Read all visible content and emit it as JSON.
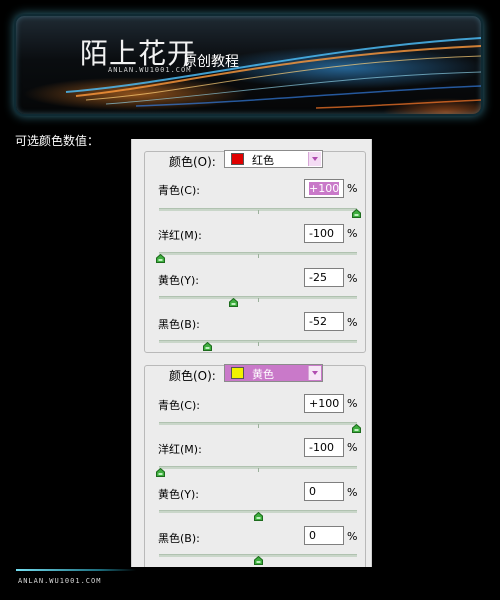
{
  "banner": {
    "title": "陌上花开",
    "subtitle": "原创教程",
    "url": "ANLAN.WU1001.COM"
  },
  "caption": "可选颜色数值：",
  "panels": [
    {
      "color_label": "颜色(O):",
      "selected_color": "红色",
      "swatch_color": "#e00000",
      "selector_highlighted": false,
      "sliders": [
        {
          "label": "青色(C):",
          "value": "+100",
          "percent_sign": "%",
          "level": 100
        },
        {
          "label": "洋红(M):",
          "value": "-100",
          "percent_sign": "%",
          "level": -100
        },
        {
          "label": "黄色(Y):",
          "value": "-25",
          "percent_sign": "%",
          "level": -25
        },
        {
          "label": "黑色(B):",
          "value": "-52",
          "percent_sign": "%",
          "level": -52
        }
      ]
    },
    {
      "color_label": "颜色(O):",
      "selected_color": "黄色",
      "swatch_color": "#f2f200",
      "selector_highlighted": true,
      "sliders": [
        {
          "label": "青色(C):",
          "value": "+100",
          "percent_sign": "%",
          "level": 100
        },
        {
          "label": "洋红(M):",
          "value": "-100",
          "percent_sign": "%",
          "level": -100
        },
        {
          "label": "黄色(Y):",
          "value": "0",
          "percent_sign": "%",
          "level": 0
        },
        {
          "label": "黑色(B):",
          "value": "0",
          "percent_sign": "%",
          "level": 0
        }
      ]
    }
  ],
  "footer": {
    "url": "ANLAN.WU1001.COM"
  },
  "colors": {
    "accent_cyan": "#76e0f2",
    "highlight_magenta": "#c979c9",
    "thumb_green": "#3fae3f"
  }
}
